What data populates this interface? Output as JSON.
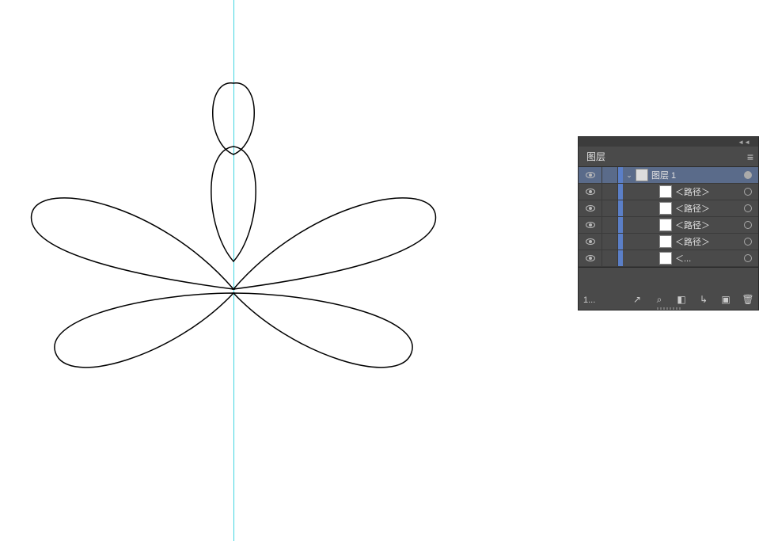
{
  "panel": {
    "title": "图层",
    "main_layer": "图层 1",
    "sublayers": [
      "＜路径＞",
      "＜路径＞",
      "＜路径＞",
      "＜路径＞",
      "＜..."
    ],
    "footer_count": "1..."
  }
}
